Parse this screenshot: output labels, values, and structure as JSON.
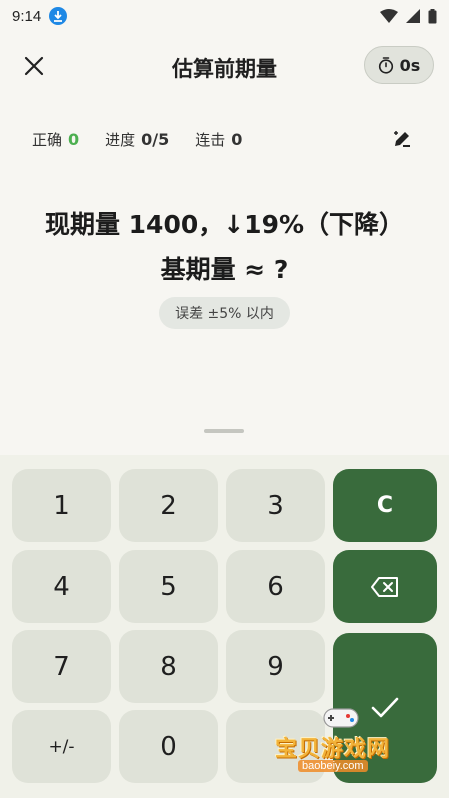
{
  "statusbar": {
    "time": "9:14"
  },
  "header": {
    "title": "估算前期量",
    "timer": "0s"
  },
  "stats": {
    "correct_label": "正确",
    "correct_value": "0",
    "progress_label": "进度",
    "progress_value": "0/5",
    "combo_label": "连击",
    "combo_value": "0"
  },
  "question": {
    "line1": "现期量 1400，↓19%（下降）",
    "line2": "基期量 ≈ ?",
    "tolerance": "误差 ±5% 以内"
  },
  "keypad": {
    "k1": "1",
    "k2": "2",
    "k3": "3",
    "k4": "4",
    "k5": "5",
    "k6": "6",
    "k7": "7",
    "k8": "8",
    "k9": "9",
    "sign": "+/-",
    "k0": "0",
    "clear": "C"
  },
  "watermark": {
    "text": "宝贝游戏网",
    "url": "baobeiy.com"
  },
  "colors": {
    "accent_green": "#396b3c",
    "correct_green": "#4caf50",
    "key_bg": "#dfe2d8",
    "page_bg": "#f7f6f2"
  },
  "icons": [
    "download-icon",
    "wifi-icon",
    "signal-icon",
    "battery-icon",
    "close-icon",
    "timer-icon",
    "edit-icon",
    "backspace-icon",
    "check-icon"
  ]
}
